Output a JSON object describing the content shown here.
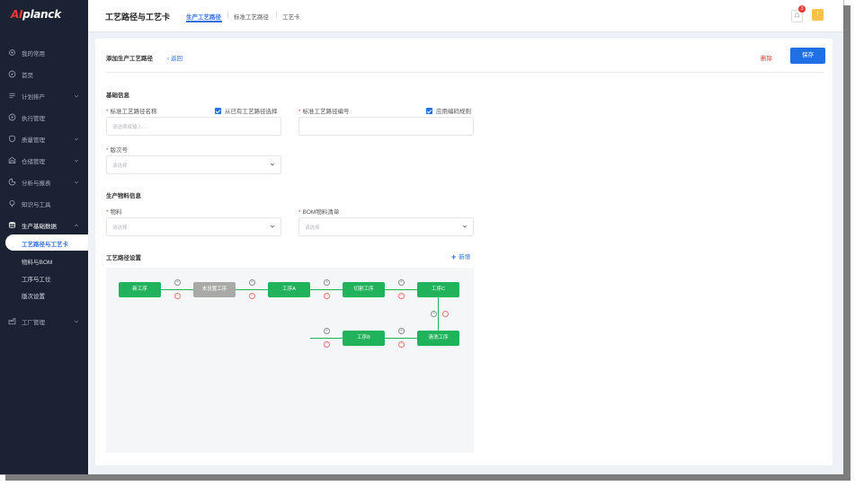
{
  "app": {
    "logo_prefix": "AI",
    "logo_suffix": "planck",
    "title": "工艺路径与工艺卡"
  },
  "tabs": [
    "生产工艺路径",
    "标准工艺路径",
    "工艺卡"
  ],
  "topbar": {
    "notification_count": "3"
  },
  "sidebar": {
    "items": [
      {
        "label": "我的常用",
        "icon": "gear-icon",
        "chevron": false
      },
      {
        "label": "首页",
        "icon": "compass-icon",
        "chevron": false
      },
      {
        "label": "计划排产",
        "icon": "list-icon",
        "chevron": true
      },
      {
        "label": "执行管理",
        "icon": "play-icon",
        "chevron": false
      },
      {
        "label": "质量管理",
        "icon": "shield-icon",
        "chevron": true
      },
      {
        "label": "仓储管理",
        "icon": "warehouse-icon",
        "chevron": true
      },
      {
        "label": "分析与报表",
        "icon": "chart-icon",
        "chevron": true
      },
      {
        "label": "知识与工具",
        "icon": "bulb-icon",
        "chevron": false
      },
      {
        "label": "生产基础数据",
        "icon": "database-icon",
        "chevron": true
      }
    ],
    "sub_items": [
      "工艺路径与工艺卡",
      "物料与BOM",
      "工序与工位",
      "版次设置"
    ],
    "factory": {
      "label": "工厂管理",
      "icon": "factory-icon"
    }
  },
  "page": {
    "title": "添加生产工艺路径",
    "back": "返回",
    "delete": "删除",
    "save": "保存"
  },
  "basic": {
    "section": "基础信息",
    "route_name_label": "标准工艺路径名称",
    "route_name_check": "从已有工艺路径选择",
    "route_name_placeholder": "请选择或输入...",
    "route_code_label": "标准工艺路径编号",
    "route_code_check": "应用编码规则",
    "version_label": "版次号",
    "version_placeholder": "请选择"
  },
  "material": {
    "section": "生产物料信息",
    "material_label": "物料",
    "material_placeholder": "请选择",
    "bom_label": "BOM物料清单",
    "bom_placeholder": "请选择"
  },
  "route_setting": {
    "section": "工艺路径设置",
    "add": "新增",
    "nodes": [
      "新工序",
      "未设置工序",
      "工序A",
      "切割工序",
      "工序C",
      "工序B",
      "清洗工序"
    ]
  },
  "colors": {
    "accent": "#1f6fe5",
    "node_green": "#21b35c",
    "node_gray": "#a9aaa8",
    "sidebar_bg": "#1b2233",
    "danger": "#e53935"
  }
}
